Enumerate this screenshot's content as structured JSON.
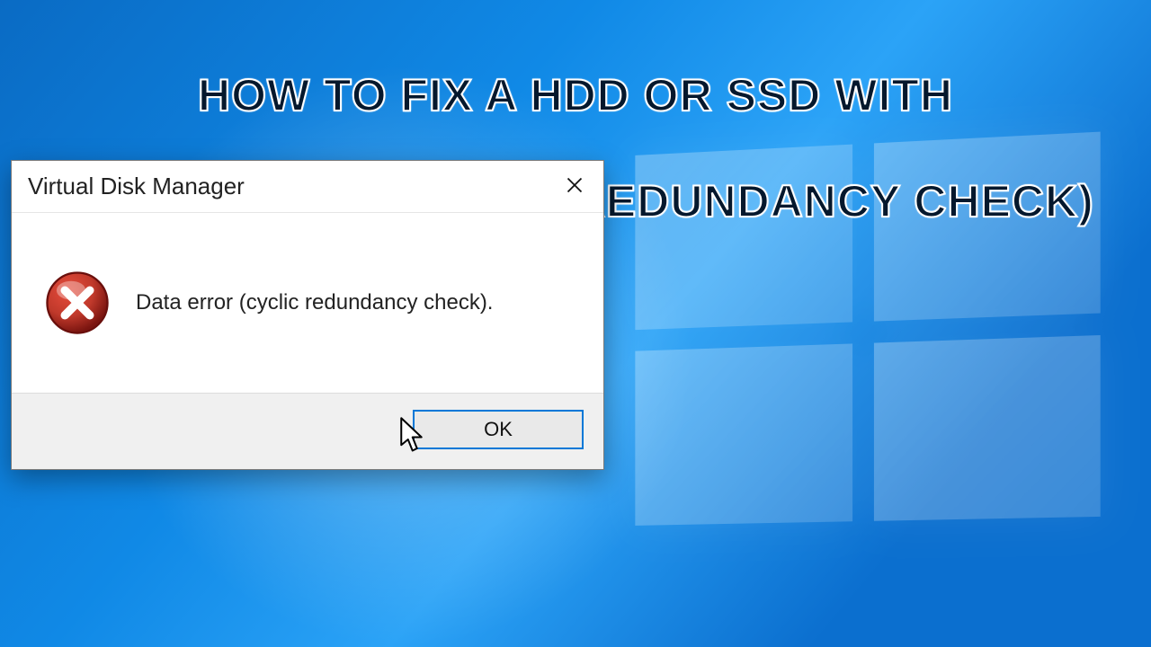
{
  "headline": {
    "line1": "HOW TO FIX A HDD OR SSD WITH",
    "line2": "DATA ERROR (CYCLIC REDUNDANCY CHECK)"
  },
  "dialog": {
    "title": "Virtual Disk Manager",
    "message": "Data error (cyclic redundancy check).",
    "ok_label": "OK"
  },
  "colors": {
    "accent": "#0078d7",
    "error_red": "#c0392b"
  }
}
